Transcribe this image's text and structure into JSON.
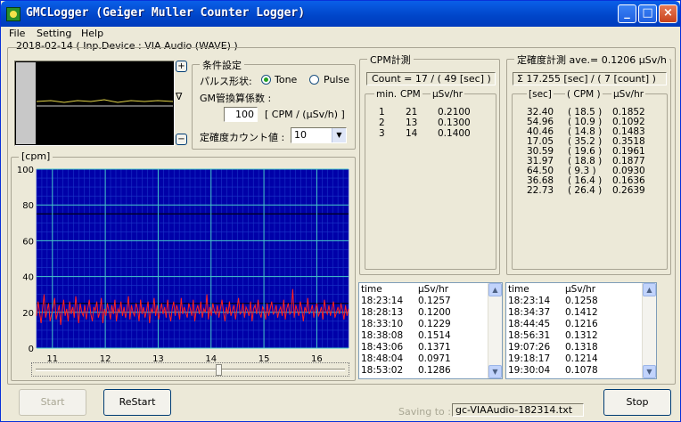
{
  "window": {
    "title": "GMCLogger (Geiger Muller Counter Logger)",
    "minimize_label": "_",
    "maximize_label": "□",
    "close_label": "×"
  },
  "menu": [
    "File",
    "Setting",
    "Help"
  ],
  "info": "2018-02-14 ( Inp.Device : VIA Audio (WAVE) )",
  "scope": {
    "plus_label": "+",
    "minus_label": "−",
    "marker_label": "∇"
  },
  "conditions": {
    "title": "条件設定",
    "pulse_label": "パルス形状:",
    "tone_label": "Tone",
    "pulse_option_label": "Pulse",
    "selected": "Tone",
    "gm_label": "GM管換算係数 :",
    "gm_value": "100",
    "gm_unit": "[ CPM / (μSv/h) ]",
    "count_label": "定確度カウント値 :",
    "count_value": "10"
  },
  "cpm": {
    "title": "CPM計測",
    "count_display": "Count = 17 / ( 49 [sec] )",
    "headers": [
      "min.",
      "CPM",
      "μSv/hr"
    ],
    "rows": [
      [
        "1",
        "21",
        "0.2100"
      ],
      [
        "2",
        "13",
        "0.1300"
      ],
      [
        "3",
        "14",
        "0.1400"
      ]
    ]
  },
  "precision": {
    "title": "定確度計測 ave.= 0.1206 μSv/h",
    "sum_display": "Σ 17.255 [sec] / ( 7 [count] )",
    "headers": [
      "[sec]",
      "( CPM )",
      "μSv/hr"
    ],
    "rows": [
      [
        "32.40",
        "( 18.5 )",
        "0.1852"
      ],
      [
        "54.96",
        "( 10.9 )",
        "0.1092"
      ],
      [
        "40.46",
        "( 14.8 )",
        "0.1483"
      ],
      [
        "17.05",
        "( 35.2 )",
        "0.3518"
      ],
      [
        "30.59",
        "( 19.6 )",
        "0.1961"
      ],
      [
        "31.97",
        "( 18.8 )",
        "0.1877"
      ],
      [
        "64.50",
        "( 9.3 )",
        "0.0930"
      ],
      [
        "36.68",
        "( 16.4 )",
        "0.1636"
      ],
      [
        "22.73",
        "( 26.4 )",
        "0.2639"
      ]
    ]
  },
  "log_left": {
    "headers": [
      "time",
      "μSv/hr"
    ],
    "rows": [
      [
        "18:23:14",
        "0.1257"
      ],
      [
        "18:28:13",
        "0.1200"
      ],
      [
        "18:33:10",
        "0.1229"
      ],
      [
        "18:38:08",
        "0.1514"
      ],
      [
        "18:43:06",
        "0.1371"
      ],
      [
        "18:48:04",
        "0.0971"
      ],
      [
        "18:53:02",
        "0.1286"
      ]
    ]
  },
  "log_right": {
    "headers": [
      "time",
      "μSv/hr"
    ],
    "rows": [
      [
        "18:23:14",
        "0.1258"
      ],
      [
        "18:34:37",
        "0.1412"
      ],
      [
        "18:44:45",
        "0.1216"
      ],
      [
        "18:56:31",
        "0.1312"
      ],
      [
        "19:07:26",
        "0.1318"
      ],
      [
        "19:18:17",
        "0.1214"
      ],
      [
        "19:30:04",
        "0.1078"
      ]
    ]
  },
  "buttons": {
    "start": "Start",
    "restart": "ReStart",
    "stop": "Stop"
  },
  "saving": {
    "label": "Saving to :",
    "file": "gc-VIAAudio-182314.txt"
  },
  "chart_data": {
    "type": "line",
    "ylabel": "[cpm]",
    "ylim": [
      0,
      100
    ],
    "yticks": [
      0,
      20,
      40,
      60,
      80,
      100
    ],
    "xlim": [
      10.7,
      16.6
    ],
    "xticks": [
      11,
      12,
      13,
      14,
      15,
      16
    ],
    "grid": true,
    "colors": {
      "background": "#0000a8",
      "grid": "#46c8c8",
      "series": "#ff2020"
    },
    "series": [
      {
        "values": [
          18,
          26,
          20,
          14,
          22,
          30,
          17,
          21,
          25,
          15,
          19,
          23,
          28,
          16,
          20,
          24,
          13,
          21,
          27,
          18,
          22,
          15,
          26,
          19,
          23,
          17,
          29,
          21,
          14,
          25,
          20,
          18,
          24,
          16,
          22,
          27,
          19,
          15,
          23,
          21,
          26,
          17,
          20,
          28,
          14,
          22,
          18,
          25,
          21,
          16,
          24,
          19,
          27,
          15,
          22,
          20,
          26,
          18,
          23,
          17,
          21,
          29,
          16,
          24,
          20,
          18,
          25,
          22,
          15,
          27,
          19,
          23,
          17,
          21,
          26,
          14,
          22,
          20,
          28,
          18,
          24,
          16,
          21,
          25,
          19,
          23,
          17,
          27,
          20,
          15,
          22,
          26,
          18,
          24,
          21,
          16,
          28,
          19,
          23,
          20,
          17,
          25,
          22,
          18,
          27,
          15,
          21,
          24,
          19,
          26,
          17,
          22,
          20,
          30,
          16,
          23,
          18,
          25,
          21,
          19,
          24,
          17,
          22,
          27,
          20,
          15,
          23,
          19,
          26,
          18,
          21,
          24,
          16,
          22,
          28,
          19,
          20,
          25,
          17,
          23,
          21,
          18,
          26,
          15,
          22,
          24,
          19,
          27,
          20,
          17,
          23,
          21,
          16,
          25,
          18,
          22,
          26,
          19,
          20,
          24,
          17,
          21,
          23,
          18,
          27,
          16,
          22,
          25,
          19,
          20,
          33,
          17,
          24,
          21,
          18,
          26,
          22,
          15,
          23,
          20,
          28,
          19,
          21,
          24,
          17,
          22,
          25,
          18,
          20,
          23,
          16,
          27,
          21,
          19,
          24,
          18,
          22,
          26,
          17,
          20,
          23,
          19,
          25,
          21,
          16,
          24,
          18,
          22
        ]
      }
    ]
  }
}
